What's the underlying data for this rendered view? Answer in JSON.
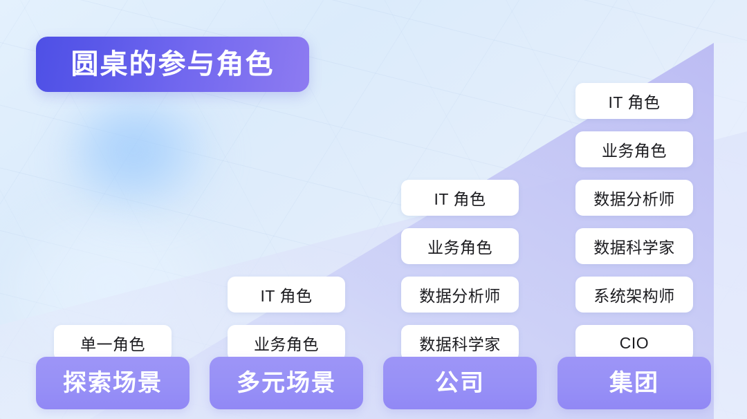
{
  "slide": {
    "title": "圆桌的参与角色",
    "background_color": "#e2eefb",
    "accent_purple": "#9790f6",
    "title_gradient_from": "#4e50e6",
    "title_gradient_to": "#8d7bf1",
    "ramp_color": "#bfc0f4",
    "card_background": "#ffffff",
    "card_text_color": "#1b1b1f"
  },
  "columns": [
    {
      "footer_label": "探索场景",
      "cards": [
        "单一角色"
      ]
    },
    {
      "footer_label": "多元场景",
      "cards": [
        "业务角色",
        "IT 角色"
      ]
    },
    {
      "footer_label": "公司",
      "cards": [
        "数据科学家",
        "数据分析师",
        "业务角色",
        "IT 角色"
      ]
    },
    {
      "footer_label": "集团",
      "cards": [
        "CIO",
        "系统架构师",
        "数据科学家",
        "数据分析师",
        "业务角色",
        "IT 角色"
      ]
    }
  ]
}
